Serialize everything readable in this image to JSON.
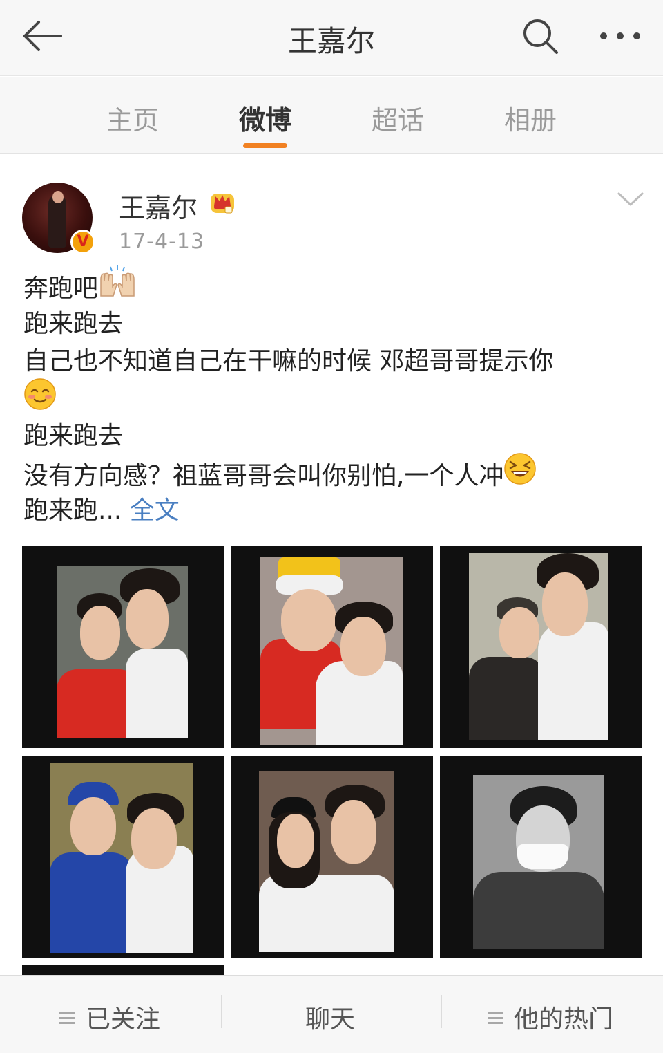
{
  "header": {
    "title": "王嘉尔",
    "back_icon": "arrow-left-icon",
    "search_icon": "search-icon",
    "more_icon": "more-dots-icon"
  },
  "tabs": [
    {
      "label": "主页",
      "active": false
    },
    {
      "label": "微博",
      "active": true
    },
    {
      "label": "超话",
      "active": false
    },
    {
      "label": "相册",
      "active": false
    }
  ],
  "accent_color": "#f18122",
  "link_color": "#4a7fc1",
  "post": {
    "author": "王嘉尔",
    "verified_badge": "V",
    "member_icon": "crown-icon",
    "date": "17-4-13",
    "lines": [
      "奔跑吧",
      "跑来跑去",
      "自己也不知道自己在干嘛的时候 邓超哥哥提示你",
      "",
      "跑来跑去",
      "没有方向感？祖蓝哥哥会叫你别怕,一个人冲",
      "跑来跑..."
    ],
    "full_text_link": "全文",
    "emojis": [
      "raised-hands-emoji",
      "smiling-blush-emoji",
      "laughing-emoji"
    ],
    "photo_count_visible": 7
  },
  "bottom_bar": {
    "follow": "已关注",
    "chat": "聊天",
    "hot": "他的热门"
  }
}
